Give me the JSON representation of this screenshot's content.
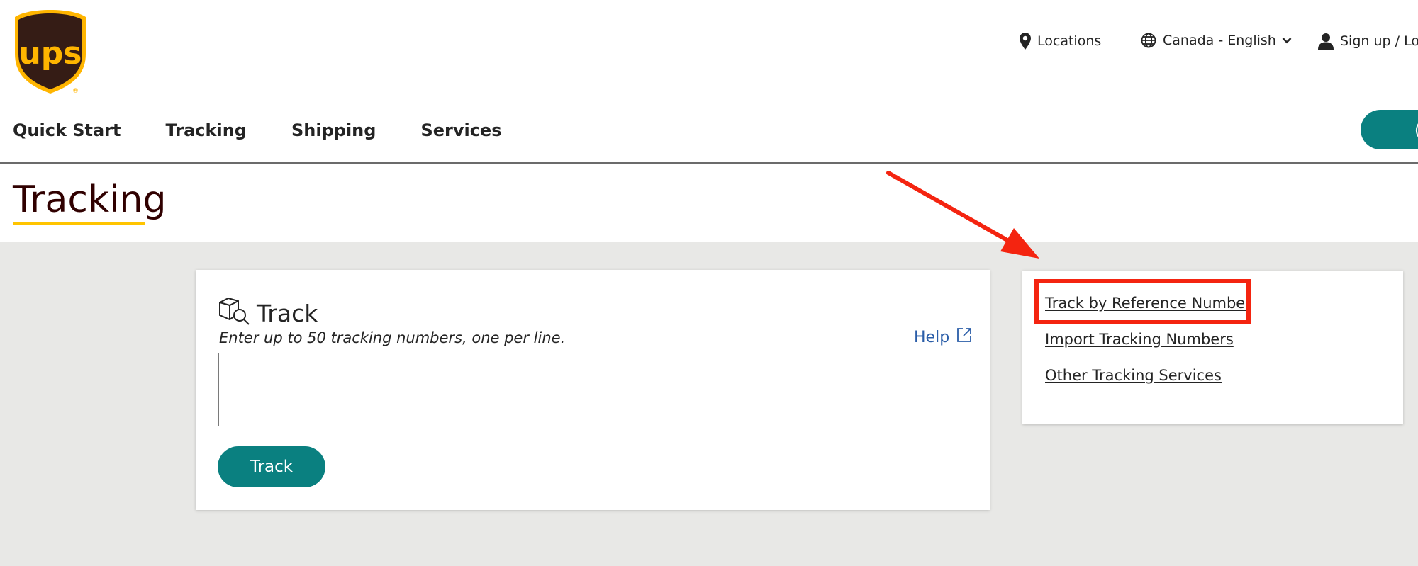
{
  "header": {
    "logo_text": "ups",
    "locations_label": "Locations",
    "language_label": "Canada - English",
    "signup_label": "Sign up / Log"
  },
  "nav": {
    "items": [
      "Quick Start",
      "Tracking",
      "Shipping",
      "Services"
    ],
    "cta_label": "("
  },
  "page": {
    "title": "Tracking"
  },
  "track_card": {
    "heading": "Track",
    "instructions": "Enter up to 50 tracking numbers, one per line.",
    "help_label": "Help",
    "input_value": "",
    "button_label": "Track"
  },
  "side_links": [
    "Track by Reference Number",
    "Import Tracking Numbers",
    "Other Tracking Services"
  ],
  "colors": {
    "brand_brown": "#351c15",
    "brand_gold": "#ffb500",
    "primary_teal": "#0a8080",
    "annotation_red": "#f42410",
    "band_grey": "#e8e8e6"
  }
}
